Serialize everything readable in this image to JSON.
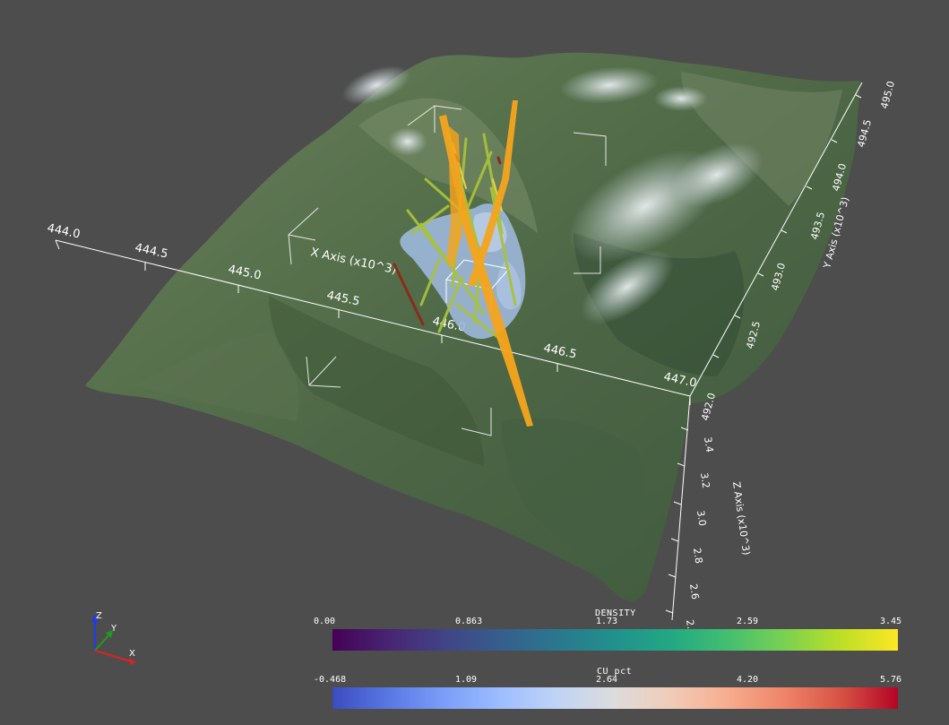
{
  "scene": {
    "background": "#4d4d4d",
    "x_axis": {
      "title": "X Axis (x10^3)",
      "ticks": [
        "444.0",
        "444.5",
        "445.0",
        "445.5",
        "446.0",
        "446.5",
        "447.0"
      ]
    },
    "y_axis": {
      "title": "Y Axis (x10^3)",
      "ticks": [
        "492.0",
        "492.5",
        "493.0",
        "493.5",
        "494.0",
        "494.5",
        "495.0"
      ]
    },
    "z_axis": {
      "title": "Z Axis (x10^3)",
      "ticks": [
        "2.4",
        "2.6",
        "2.8",
        "3.0",
        "3.2",
        "3.4"
      ]
    },
    "orientation_widget": {
      "x": "X",
      "y": "Y",
      "z": "Z"
    }
  },
  "colorbars": {
    "density": {
      "title": "DENSITY",
      "ticks": [
        "0.00",
        "0.863",
        "1.73",
        "2.59",
        "3.45"
      ],
      "colormap": "viridis"
    },
    "cu_pct": {
      "title": "CU_pct",
      "ticks": [
        "-0.468",
        "1.09",
        "2.64",
        "4.20",
        "5.76"
      ],
      "colormap": "coolwarm"
    }
  }
}
